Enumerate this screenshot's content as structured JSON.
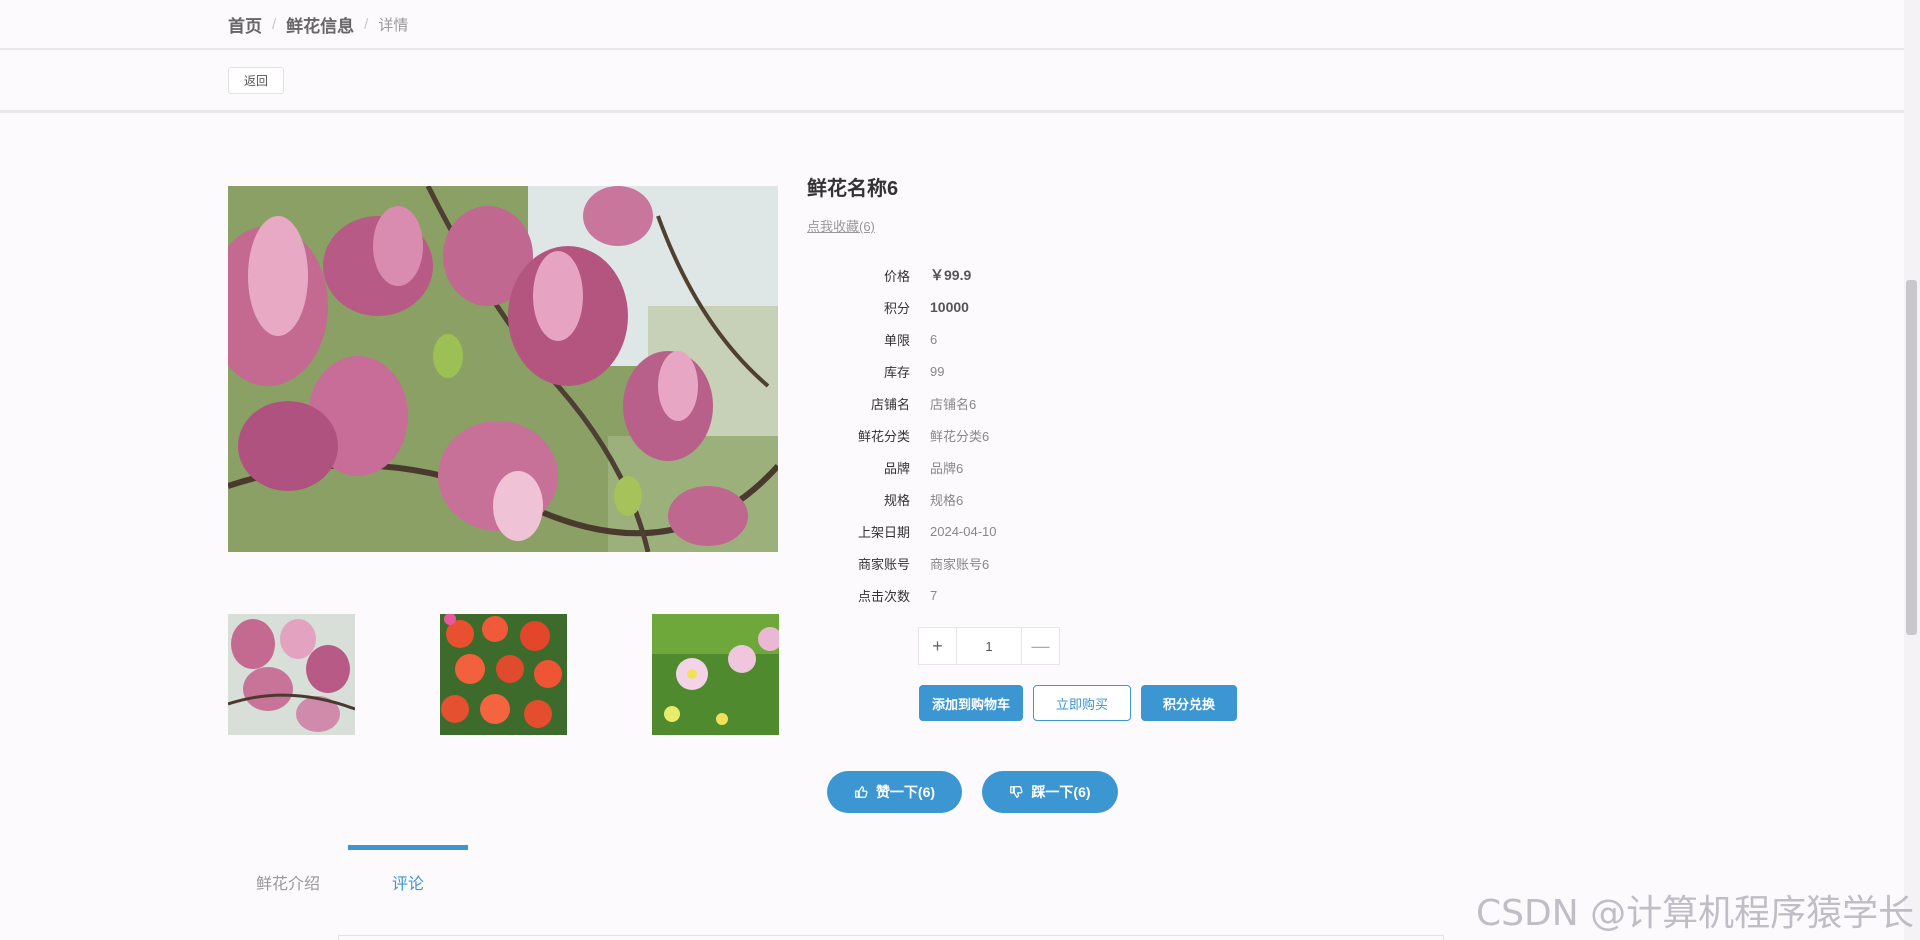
{
  "breadcrumb": {
    "home": "首页",
    "section": "鲜花信息",
    "current": "详情",
    "separator": "/"
  },
  "toolbar": {
    "back_label": "返回"
  },
  "product": {
    "name": "鲜花名称6",
    "favorite_link": "点我收藏(6)",
    "fields": [
      {
        "label": "价格",
        "value": "￥99.9"
      },
      {
        "label": "积分",
        "value": "10000"
      },
      {
        "label": "单限",
        "value": "6"
      },
      {
        "label": "库存",
        "value": "99"
      },
      {
        "label": "店铺名",
        "value": "店铺名6"
      },
      {
        "label": "鲜花分类",
        "value": "鲜花分类6"
      },
      {
        "label": "品牌",
        "value": "品牌6"
      },
      {
        "label": "规格",
        "value": "规格6"
      },
      {
        "label": "上架日期",
        "value": "2024-04-10"
      },
      {
        "label": "商家账号",
        "value": "商家账号6"
      },
      {
        "label": "点击次数",
        "value": "7"
      }
    ]
  },
  "quantity": {
    "value": "1",
    "plus": "+",
    "minus": "—"
  },
  "actions": {
    "add_to_cart": "添加到购物车",
    "buy_now": "立即购买",
    "points_exchange": "积分兑换"
  },
  "votes": {
    "like": "赞一下(6)",
    "dislike": "踩一下(6)"
  },
  "tabs": [
    {
      "label": "鲜花介绍",
      "active": false
    },
    {
      "label": "评论",
      "active": true
    }
  ],
  "watermark": "CSDN @计算机程序猿学长",
  "colors": {
    "accent": "#3b96d2",
    "background": "#fdfafd"
  },
  "icons": {
    "like": "thumbs-up-icon",
    "dislike": "thumbs-down-icon"
  }
}
